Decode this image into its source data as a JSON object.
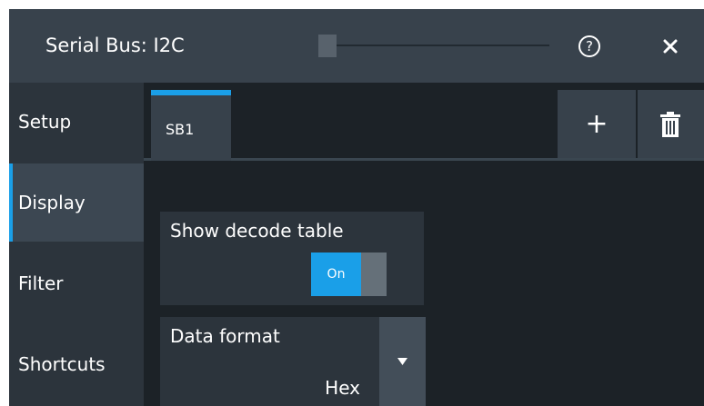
{
  "dialog": {
    "title": "Serial Bus: I2C",
    "help_glyph": "?",
    "icons": {
      "help": "help-circle-icon",
      "close": "close-icon"
    },
    "accent_color": "#1a9fe8"
  },
  "sidebar": {
    "items": [
      {
        "label": "Setup",
        "active": false
      },
      {
        "label": "Display",
        "active": true
      },
      {
        "label": "Filter",
        "active": false
      },
      {
        "label": "Shortcuts",
        "active": false
      }
    ]
  },
  "tabs": {
    "items": [
      {
        "label": "SB1",
        "active": true
      }
    ],
    "add_label": "+",
    "icons": {
      "add": "plus-icon",
      "delete": "trash-icon"
    }
  },
  "display": {
    "decode_table": {
      "label": "Show decode table",
      "toggle_text": "On",
      "value": true
    },
    "data_format": {
      "label": "Data format",
      "value": "Hex",
      "icon": "dropdown-arrow-icon"
    }
  }
}
